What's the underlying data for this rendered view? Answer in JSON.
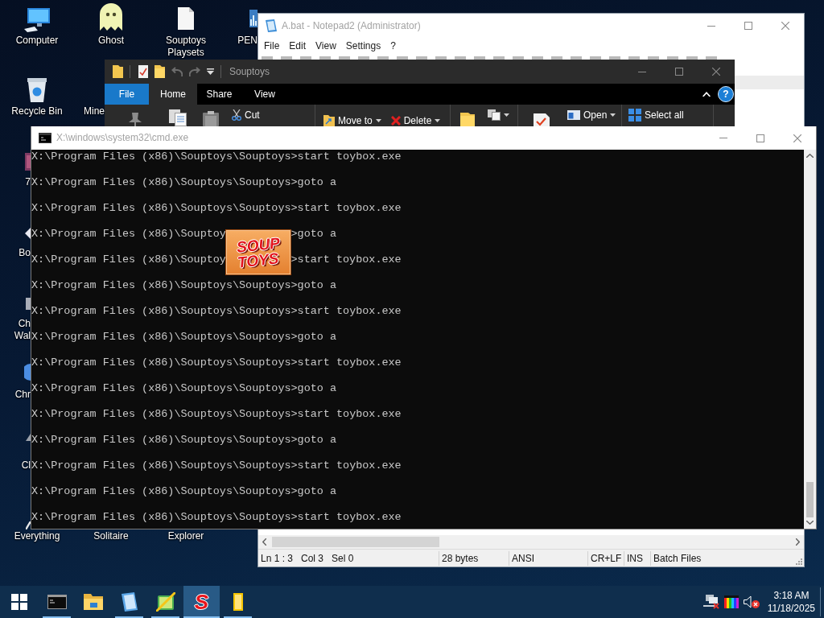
{
  "desktop_icons": [
    {
      "label": "Computer",
      "kind": "computer"
    },
    {
      "label": "Ghost",
      "kind": "ghost"
    },
    {
      "label": "Souptoys Playsets",
      "kind": "document"
    },
    {
      "label": "PEN",
      "kind": "chart"
    },
    {
      "label": "Recycle Bin",
      "kind": "recycle"
    },
    {
      "label": "Mine"
    },
    {
      "label": "7",
      "kind": "archive"
    },
    {
      "label": "Bo",
      "kind": "arrow"
    },
    {
      "label": "Ch Wal",
      "kind": "box"
    },
    {
      "label": "Chr",
      "kind": "globe"
    },
    {
      "label": "Cl",
      "kind": "tool"
    },
    {
      "label": "Everything",
      "kind": "magnifier"
    },
    {
      "label": "Solitaire"
    },
    {
      "label": "Explorer"
    }
  ],
  "notepad": {
    "title": "A.bat - Notepad2 (Administrator)",
    "menu": [
      "File",
      "Edit",
      "View",
      "Settings",
      "?"
    ],
    "status_bar": [
      "Ln 1 : 3   Col 3   Sel 0",
      "28 bytes",
      "ANSI",
      "CR+LF",
      "INS",
      "Batch Files"
    ]
  },
  "explorer": {
    "title": "Souptoys",
    "tabs": [
      {
        "label": "File",
        "kind": "menu",
        "selected": false
      },
      {
        "label": "Home",
        "kind": "tab",
        "selected": true
      },
      {
        "label": "Share",
        "kind": "tab",
        "selected": false
      },
      {
        "label": "View",
        "kind": "tab",
        "selected": false
      }
    ],
    "help_button": "?",
    "ribbon_buttons": [
      {
        "label": "Cut",
        "dropdown": false
      },
      {
        "label": "Move to",
        "dropdown": true
      },
      {
        "label": "Delete",
        "dropdown": true
      },
      {
        "label": "Open",
        "dropdown": true
      },
      {
        "label": "Select all",
        "dropdown": false
      }
    ]
  },
  "console": {
    "title": "X:\\windows\\system32\\cmd.exe",
    "lines": [
      {
        "parts": [
          "X:\\Program Files (x86)\\Souptoys\\Souptoys>start toybox.exe"
        ]
      },
      {
        "parts": [
          "X:\\Program Files (x86)\\Souptoys\\Souptoys>goto a"
        ]
      },
      {
        "parts": [
          "X:\\Program Files (x86)\\Souptoys\\Souptoys>start toybox.exe"
        ]
      },
      {
        "parts": [
          "X:\\Program Files (x86)\\Souptoy",
          ">goto a"
        ]
      },
      {
        "parts": [
          "X:\\Program Files (x86)\\Souptoy",
          ">start toybox.exe"
        ]
      },
      {
        "parts": [
          "X:\\Program Files (x86)\\Souptoys\\Souptoys>goto a"
        ]
      },
      {
        "parts": [
          "X:\\Program Files (x86)\\Souptoys\\Souptoys>start toybox.exe"
        ]
      },
      {
        "parts": [
          "X:\\Program Files (x86)\\Souptoys\\Souptoys>goto a"
        ]
      },
      {
        "parts": [
          "X:\\Program Files (x86)\\Souptoys\\Souptoys>start toybox.exe"
        ]
      },
      {
        "parts": [
          "X:\\Program Files (x86)\\Souptoys\\Souptoys>goto a"
        ]
      },
      {
        "parts": [
          "X:\\Program Files (x86)\\Souptoys\\Souptoys>start toybox.exe"
        ]
      },
      {
        "parts": [
          "X:\\Program Files (x86)\\Souptoys\\Souptoys>goto a"
        ]
      },
      {
        "parts": [
          "X:\\Program Files (x86)\\Souptoys\\Souptoys>start toybox.exe"
        ]
      },
      {
        "parts": [
          "X:\\Program Files (x86)\\Souptoys\\Souptoys>goto a"
        ]
      },
      {
        "parts": [
          "X:\\Program Files (x86)\\Souptoys\\Souptoys>start toybox.exe"
        ]
      }
    ]
  },
  "splash_logo": {
    "lines": [
      "SOUP",
      "TOYS"
    ]
  },
  "taskbar": {
    "items": [
      {
        "kind": "console",
        "running": true,
        "active": false
      },
      {
        "kind": "folder",
        "running": false,
        "active": false
      },
      {
        "kind": "notepad",
        "running": true,
        "active": false
      },
      {
        "kind": "paint",
        "running": true,
        "active": false
      },
      {
        "kind": "souptoys",
        "glyph": "S",
        "running": true,
        "active": true
      },
      {
        "kind": "file",
        "running": true,
        "active": false
      }
    ],
    "tray": {
      "network_connected": false,
      "muted": true,
      "time": "3:18 AM",
      "date": "11/18/2025"
    }
  }
}
